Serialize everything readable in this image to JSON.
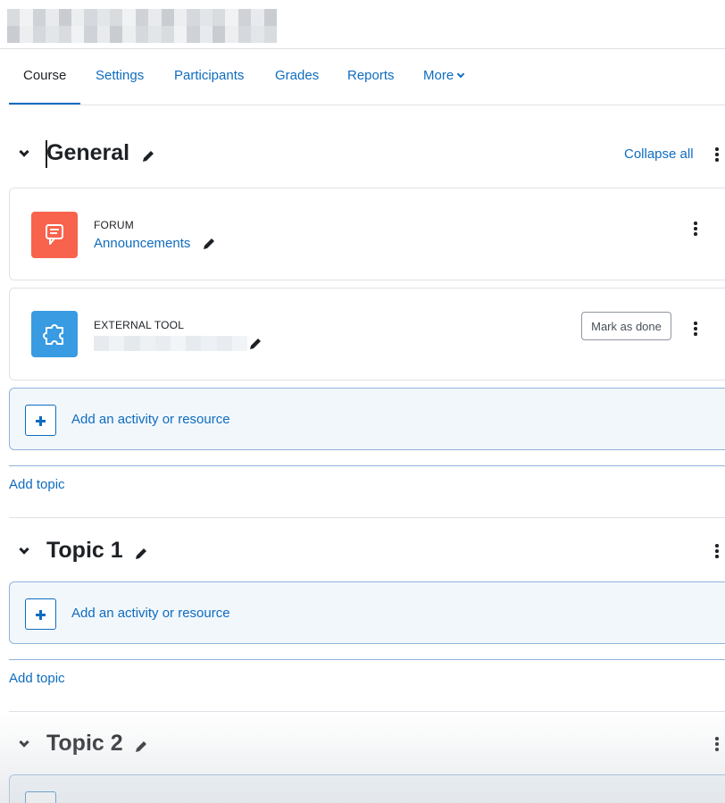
{
  "tabs": [
    {
      "label": "Course"
    },
    {
      "label": "Settings"
    },
    {
      "label": "Participants"
    },
    {
      "label": "Grades"
    },
    {
      "label": "Reports"
    },
    {
      "label": "More"
    }
  ],
  "collapse_all": "Collapse all",
  "sections": [
    {
      "title": "General"
    },
    {
      "title": "Topic 1"
    },
    {
      "title": "Topic 2"
    }
  ],
  "activities": [
    {
      "type": "FORUM",
      "name": "Announcements",
      "icon": "forum-icon",
      "color": "#f7634d"
    },
    {
      "type": "EXTERNAL TOOL",
      "name": "",
      "icon": "puzzle-icon",
      "color": "#399be2",
      "mark_done": "Mark as done"
    }
  ],
  "add_activity_label": "Add an activity or resource",
  "add_topic_label": "Add topic",
  "colors": {
    "link": "#0f6cbf",
    "forum": "#f7634d",
    "external_tool": "#399be2"
  }
}
